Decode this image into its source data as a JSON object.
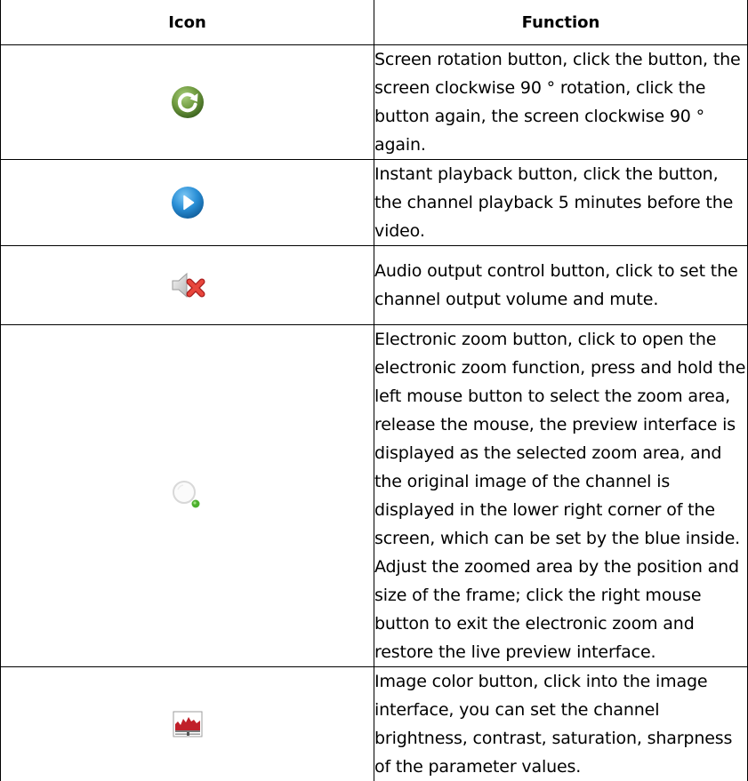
{
  "table": {
    "headers": {
      "icon": "Icon",
      "function": "Function"
    },
    "rows": [
      {
        "icon": "rotate-icon",
        "color": "#5e8a34",
        "text": "Screen rotation button, click the button, the screen clockwise 90 ° rotation, click the button again, the screen clockwise 90 ° again."
      },
      {
        "icon": "play-icon",
        "color": "#2a8fd6",
        "text": "Instant playback button, click the button, the channel playback 5 minutes before the video."
      },
      {
        "icon": "speaker-mute-icon",
        "color": "#d9342b",
        "text": "Audio output control button, click to set the channel output volume and mute."
      },
      {
        "icon": "zoom-magnifier-icon",
        "color": "#4caf2e",
        "text": "Electronic zoom button, click to open the electronic zoom function, press and hold the left mouse button to select the zoom area, release the mouse, the preview interface is displayed as the selected zoom area, and the original image of the channel is displayed in the lower right corner of the screen, which can be set by the blue inside. Adjust the zoomed area by the position and size of the frame; click the right mouse button to exit the electronic zoom and restore the live preview interface."
      },
      {
        "icon": "image-color-icon",
        "color": "#c0202a",
        "text": "Image color button, click into the image interface, you can set the channel brightness, contrast, saturation, sharpness of the parameter values."
      }
    ]
  }
}
